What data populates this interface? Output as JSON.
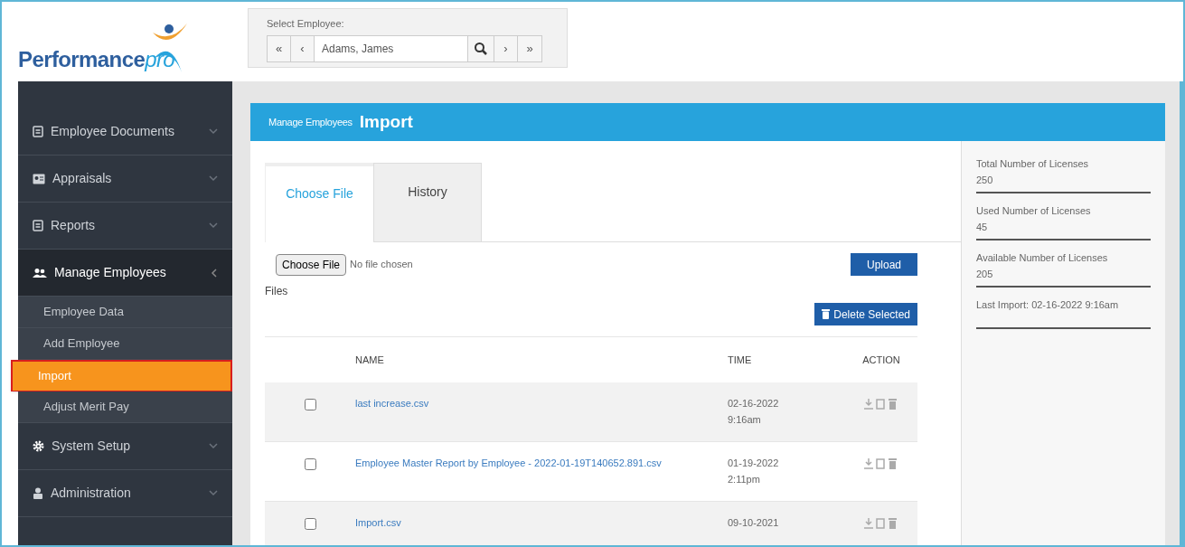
{
  "logo": {
    "text": "Performance",
    "accent": "pro"
  },
  "employee_selector": {
    "label": "Select Employee:",
    "value": "Adams, James",
    "buttons": [
      "«",
      "‹",
      "›",
      "»"
    ]
  },
  "sidebar": {
    "items": [
      {
        "label": "Employee Documents",
        "expanded": false
      },
      {
        "label": "Appraisals",
        "expanded": false
      },
      {
        "label": "Reports",
        "expanded": false
      },
      {
        "label": "Manage Employees",
        "expanded": true,
        "children": [
          {
            "label": "Employee Data",
            "selected": false
          },
          {
            "label": "Add Employee",
            "selected": false
          },
          {
            "label": "Import",
            "selected": true
          },
          {
            "label": "Adjust Merit Pay",
            "selected": false
          }
        ]
      },
      {
        "label": "System Setup",
        "expanded": false
      },
      {
        "label": "Administration",
        "expanded": false
      }
    ]
  },
  "panel": {
    "breadcrumb": "Manage Employees",
    "title": "Import"
  },
  "tabs": [
    {
      "label": "Choose File",
      "selected": true
    },
    {
      "label": "History",
      "selected": false
    }
  ],
  "file_input": {
    "button": "Choose File",
    "status": "No file chosen"
  },
  "upload_button": "Upload",
  "files_heading": "Files",
  "delete_button": "Delete Selected",
  "table": {
    "columns": [
      "NAME",
      "TIME",
      "ACTION"
    ],
    "rows": [
      {
        "checked": false,
        "name": "last increase.csv",
        "time": [
          "02-16-2022",
          "9:16am"
        ]
      },
      {
        "checked": false,
        "name": "Employee Master Report by Employee - 2022-01-19T140652.891.csv",
        "time": [
          "01-19-2022",
          "2:11pm"
        ]
      },
      {
        "checked": false,
        "name": "Import.csv",
        "time": [
          "09-10-2021"
        ]
      }
    ]
  },
  "licenses": [
    {
      "label": "Total Number of Licenses",
      "value": "250"
    },
    {
      "label": "Used Number of Licenses",
      "value": "45"
    },
    {
      "label": "Available Number of Licenses",
      "value": "205"
    },
    {
      "label": "Last Import: 02-16-2022 9:16am"
    }
  ]
}
